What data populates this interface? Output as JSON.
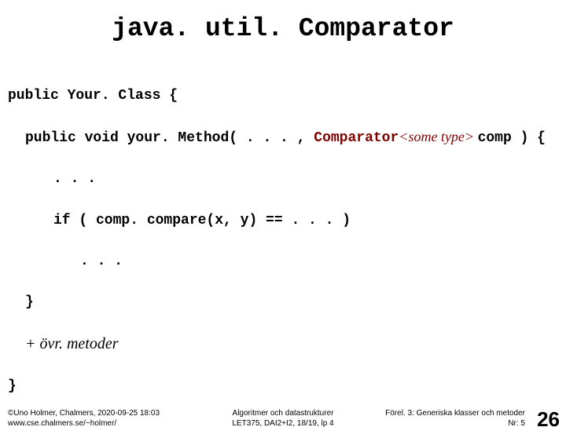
{
  "title": "java. util. Comparator",
  "code": {
    "l1_a": "public Your. Class {",
    "l2_a": "public void your. Method( . . . , ",
    "l2_b": "Comparator",
    "l2_c": "<some type> ",
    "l2_d": "comp ) {",
    "l3": ". . .",
    "l4": "if ( comp. compare(x, y) == . . . )",
    "l5": ". . .",
    "l6": "}",
    "l7": "+ övr. metoder",
    "l8": "}"
  },
  "footer": {
    "left_line1": "©Uno Holmer, Chalmers, 2020-09-25 18:03",
    "left_line2": "www.cse.chalmers.se/~holmer/",
    "center_line1": "Algoritmer och datastrukturer",
    "center_line2": "LET375, DAI2+I2, 18/19, lp 4",
    "right_line1": "Förel. 3: Generiska klasser och metoder",
    "right_line2": "Nr: 5"
  },
  "page_number": "26"
}
